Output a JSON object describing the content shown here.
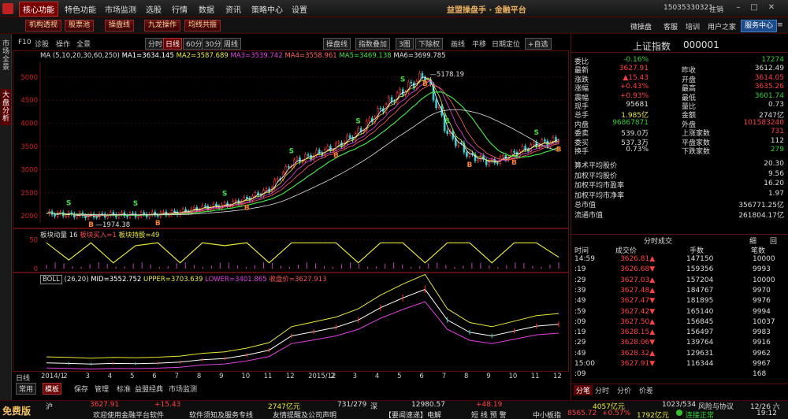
{
  "menu": {
    "items": [
      "核心功能",
      "特色功能",
      "市场监测",
      "选股",
      "行情",
      "数据",
      "资讯",
      "策略中心",
      "设置"
    ],
    "brand": "益盟操盘手 · 金融平台",
    "account": "15035330321",
    "logout": "注销"
  },
  "toolbar": {
    "red_buttons": [
      "机构透视",
      "股票池",
      "操盘线",
      "九龙操作",
      "均线共振"
    ],
    "links": [
      "微操盘",
      "客服",
      "培训",
      "用户之家"
    ],
    "service_center": "服务中心"
  },
  "left_tabs": [
    "市场全景",
    "大盘分析"
  ],
  "chart_toolbar": {
    "left": [
      "F10",
      "诊股",
      "操作",
      "全景"
    ],
    "periods": [
      "分时",
      "日线",
      "60分",
      "30分",
      "周线"
    ],
    "active_period": "日线",
    "right": [
      "操盘线",
      "指数叠加",
      "3图",
      "下除权",
      "画线",
      "平移",
      "日期定位",
      "+自选"
    ]
  },
  "main_legend": {
    "prefix": "MA",
    "params": "(5,10,20,30,60,250)",
    "items": [
      {
        "label": "MA1=3634.145",
        "color": "#ffffff"
      },
      {
        "label": "MA2=3587.689",
        "color": "#e8e830"
      },
      {
        "label": "MA3=3539.742",
        "color": "#e040e0"
      },
      {
        "label": "MA4=3558.961",
        "color": "#ff6060"
      },
      {
        "label": "MA5=3469.138",
        "color": "#40e040"
      },
      {
        "label": "MA6=3699.785",
        "color": "#e0e0e0"
      }
    ]
  },
  "sector_legend": {
    "title": "板块动量",
    "param": "16",
    "buy": "板块买入=1",
    "hold": "板块持股=49"
  },
  "boll_legend": {
    "title": "BOLL",
    "params": "(26,20)",
    "mid": "MID=3552.752",
    "upper": "UPPER=3703.639",
    "lower": "LOWER=3401.865",
    "close": "收盘价=3627.913"
  },
  "chart_data": {
    "type": "line",
    "title": "上证指数 日线",
    "y_ticks": [
      2000,
      2500,
      3000,
      3500,
      4000,
      4500,
      5000
    ],
    "ylim": [
      1850,
      5320
    ],
    "x_labels": [
      "2014/1",
      "2",
      "3",
      "4",
      "5",
      "6",
      "7",
      "8",
      "9",
      "10",
      "11",
      "12",
      "2015/12",
      "2",
      "3",
      "4",
      "5",
      "6",
      "7",
      "8",
      "9",
      "10",
      "11",
      "12"
    ],
    "series": [
      {
        "name": "收盘价",
        "values": [
          2050,
          2030,
          2000,
          2030,
          2020,
          2040,
          2080,
          2180,
          2230,
          2370,
          2570,
          3150,
          3320,
          3500,
          3800,
          4300,
          4700,
          5050,
          3800,
          3300,
          3150,
          3350,
          3550,
          3627
        ]
      }
    ],
    "annotations": [
      {
        "label": "5178.19"
      },
      {
        "label": "1974.38"
      }
    ],
    "sector_ticks": [
      0,
      50
    ],
    "sector_values": [
      45,
      15,
      45,
      10,
      40,
      45,
      10,
      45,
      40,
      45,
      10,
      45,
      45,
      45,
      10,
      45,
      45,
      10,
      45,
      45,
      10,
      45,
      45,
      20
    ]
  },
  "quote": {
    "name": "上证指数",
    "code": "000001",
    "rows": [
      {
        "l1": "委比",
        "v1": "-0.16%",
        "c1": "green",
        "l2": "",
        "v2": "17274",
        "c2": "green"
      },
      {
        "l1": "最新",
        "v1": "3627.91",
        "c1": "red",
        "l2": "昨收",
        "v2": "3612.49",
        "c2": "white"
      },
      {
        "l1": "涨跌",
        "v1": "▲15.43",
        "c1": "red",
        "l2": "开盘",
        "v2": "3614.05",
        "c2": "red"
      },
      {
        "l1": "涨幅",
        "v1": "+0.43%",
        "c1": "red",
        "l2": "最高",
        "v2": "3635.26",
        "c2": "red"
      },
      {
        "l1": "震幅",
        "v1": "+0.93%",
        "c1": "red",
        "l2": "最低",
        "v2": "3601.74",
        "c2": "green"
      },
      {
        "l1": "现手",
        "v1": "95681",
        "c1": "white",
        "l2": "量比",
        "v2": "0.73",
        "c2": "white"
      },
      {
        "l1": "总手",
        "v1": "1.985亿",
        "c1": "yellow",
        "l2": "金额",
        "v2": "2747亿",
        "c2": "white"
      },
      {
        "l1": "内盘",
        "v1": "96867871",
        "c1": "green",
        "l2": "外盘",
        "v2": "101583240",
        "c2": "red"
      },
      {
        "l1": "委卖",
        "v1": "539.0万",
        "c1": "white",
        "l2": "上涨家数",
        "v2": "731",
        "c2": "red"
      },
      {
        "l1": "委买",
        "v1": "537.3万",
        "c1": "white",
        "l2": "平盘家数",
        "v2": "112",
        "c2": "white"
      },
      {
        "l1": "换手",
        "v1": "0.73%",
        "c1": "white",
        "l2": "下跌家数",
        "v2": "279",
        "c2": "green"
      }
    ],
    "stats": [
      {
        "label": "算术平均股价",
        "value": "20.30"
      },
      {
        "label": "加权平均股价",
        "value": "9.56"
      },
      {
        "label": "加权平均市盈率",
        "value": "16.20"
      },
      {
        "label": "加权平均市净率",
        "value": "1.97"
      },
      {
        "label": "总市值",
        "value": "356771.25亿"
      },
      {
        "label": "流通市值",
        "value": "261804.17亿"
      }
    ]
  },
  "ticks": {
    "title": "分时成交",
    "tabs_right": [
      "细",
      "回"
    ],
    "headers": [
      "时间",
      "成交价",
      "手数",
      "笔数"
    ],
    "rows": [
      {
        "t": "14:59",
        "p": "3626.81▲",
        "pc": "red",
        "v": "147150",
        "n": "10000"
      },
      {
        "t": ":19",
        "p": "3626.68▼",
        "pc": "red",
        "v": "159356",
        "n": "9993"
      },
      {
        "t": ":29",
        "p": "3627.03▲",
        "pc": "red",
        "v": "157204",
        "n": "10000"
      },
      {
        "t": ":39",
        "p": "3627.48▲",
        "pc": "red",
        "v": "184767",
        "n": "9970"
      },
      {
        "t": ":49",
        "p": "3627.47▼",
        "pc": "red",
        "v": "181895",
        "n": "9976"
      },
      {
        "t": ":59",
        "p": "3627.42▼",
        "pc": "red",
        "v": "165140",
        "n": "9994"
      },
      {
        "t": ":09",
        "p": "3627.50▲",
        "pc": "red",
        "v": "156845",
        "n": "10037"
      },
      {
        "t": ":19",
        "p": "3628.15▲",
        "pc": "red",
        "v": "156497",
        "n": "9983"
      },
      {
        "t": ":29",
        "p": "3628.06▼",
        "pc": "red",
        "v": "139764",
        "n": "9916"
      },
      {
        "t": ":49",
        "p": "3628.32▲",
        "pc": "red",
        "v": "129631",
        "n": "9962"
      },
      {
        "t": "15:00",
        "p": "3627.91▼",
        "pc": "red",
        "v": "116344",
        "n": "9967"
      },
      {
        "t": ":09",
        "p": "",
        "pc": "red",
        "v": "",
        "n": "168"
      }
    ],
    "bottom_tabs": [
      "分笔",
      "分时",
      "分价",
      "价差"
    ]
  },
  "bottom_toolbar": {
    "left_items": [
      "日线",
      "常用",
      "模板",
      "保存",
      "管理",
      "标准",
      "益盟经典",
      "市场监测"
    ]
  },
  "status": {
    "free": "免费版",
    "hu_label": "沪",
    "hu_price": "3627.91",
    "hu_change": "+15.43",
    "hu_amount": "2747亿元",
    "hu_counts": "731/279",
    "shen_label": "深",
    "shen_price": "12980.57",
    "shen_change": "+48.19",
    "shen_amount": "4057亿元",
    "shen_counts": "1023/534",
    "welcome": "欢迎使用金融平台软件",
    "notice1": "软件须知及服务专线",
    "notice2": "友情提醒及公司声明",
    "telegram": "【要闻速递】电解",
    "scroll": "短 线 预 警",
    "smallcap": "中小板指",
    "smallcap_price": "8565.72",
    "smallcap_change": "+0.57%",
    "smallcap_amount": "1792亿元",
    "agreement": "风险与协议",
    "date": "12/26 六",
    "connection": "连接正常",
    "time": "19:12"
  }
}
